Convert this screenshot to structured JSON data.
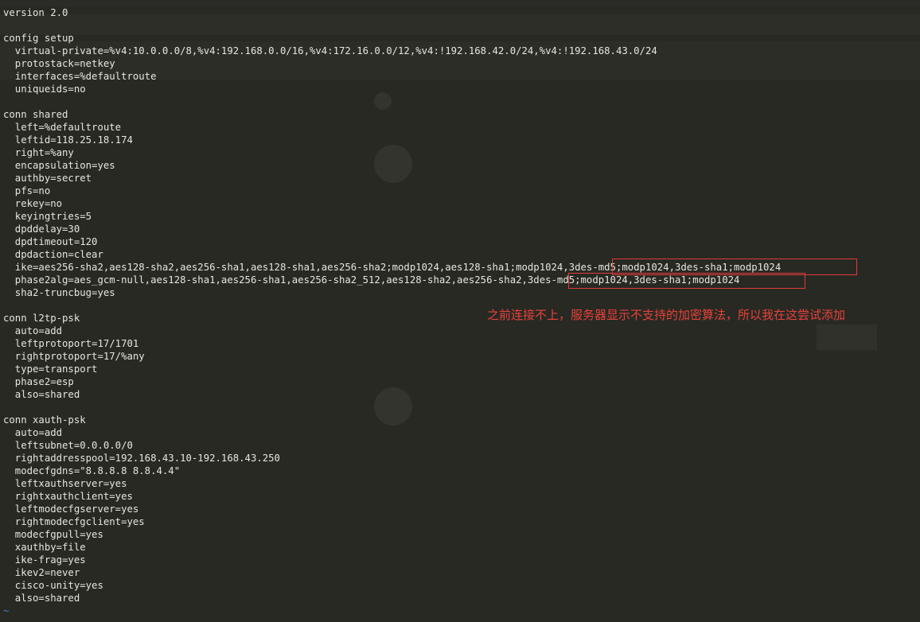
{
  "editor": {
    "lines": [
      "version 2.0",
      "",
      "config setup",
      "  virtual-private=%v4:10.0.0.0/8,%v4:192.168.0.0/16,%v4:172.16.0.0/12,%v4:!192.168.42.0/24,%v4:!192.168.43.0/24",
      "  protostack=netkey",
      "  interfaces=%defaultroute",
      "  uniqueids=no",
      "",
      "conn shared",
      "  left=%defaultroute",
      "  leftid=118.25.18.174",
      "  right=%any",
      "  encapsulation=yes",
      "  authby=secret",
      "  pfs=no",
      "  rekey=no",
      "  keyingtries=5",
      "  dpddelay=30",
      "  dpdtimeout=120",
      "  dpdaction=clear",
      "  ike=aes256-sha2,aes128-sha2,aes256-sha1,aes128-sha1,aes256-sha2;modp1024,aes128-sha1;modp1024,3des-md5;modp1024,3des-sha1;modp1024",
      "  phase2alg=aes_gcm-null,aes128-sha1,aes256-sha1,aes256-sha2_512,aes128-sha2,aes256-sha2,3des-md5;modp1024,3des-sha1;modp1024",
      "  sha2-truncbug=yes",
      "",
      "conn l2tp-psk",
      "  auto=add",
      "  leftprotoport=17/1701",
      "  rightprotoport=17/%any",
      "  type=transport",
      "  phase2=esp",
      "  also=shared",
      "",
      "conn xauth-psk",
      "  auto=add",
      "  leftsubnet=0.0.0.0/0",
      "  rightaddresspool=192.168.43.10-192.168.43.250",
      "  modecfgdns=\"8.8.8.8 8.8.4.4\"",
      "  leftxauthserver=yes",
      "  rightxauthclient=yes",
      "  leftmodecfgserver=yes",
      "  rightmodecfgclient=yes",
      "  modecfgpull=yes",
      "  xauthby=file",
      "  ike-frag=yes",
      "  ikev2=never",
      "  cisco-unity=yes",
      "  also=shared"
    ],
    "end_marker": "~"
  },
  "annotation": {
    "text": "之前连接不上，服务器显示不支持的加密算法，所以我在这尝试添加",
    "color": "#e8413a"
  },
  "colors": {
    "background": "#282923",
    "text": "#e6e6e0",
    "highlight_border": "#e03a3a",
    "tilde": "#4c74d8"
  }
}
